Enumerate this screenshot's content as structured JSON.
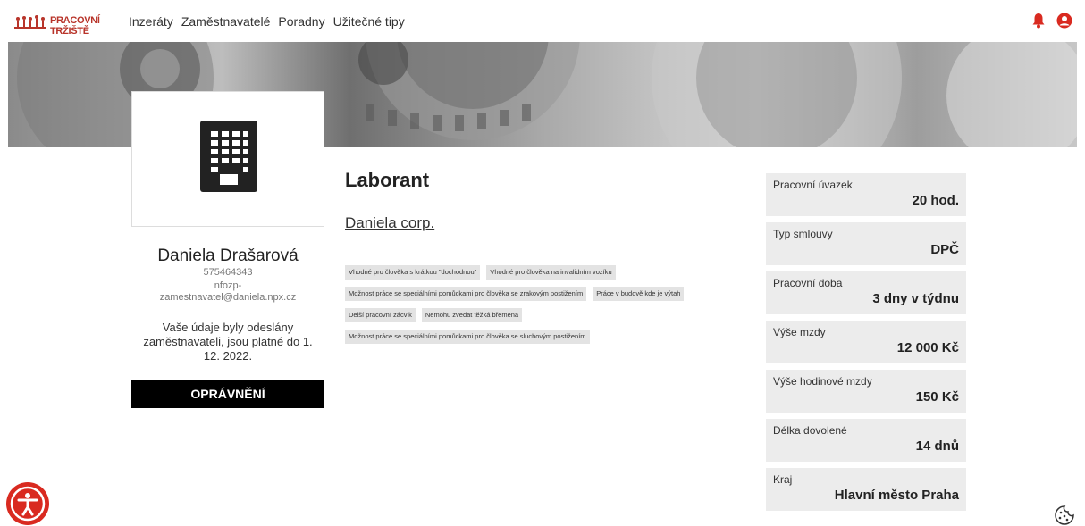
{
  "header": {
    "logo_text": "PRACOVNÍ TRŽIŠTĚ",
    "nav": [
      "Inzeráty",
      "Zaměstnavatelé",
      "Poradny",
      "Užitečné tipy"
    ]
  },
  "profile": {
    "name": "Daniela Drašarová",
    "phone": "575464343",
    "email": "nfozp-zamestnavatel@daniela.npx.cz",
    "status": "Vaše údaje byly odeslány zaměstnavateli, jsou platné do 1. 12. 2022.",
    "button": "OPRÁVNĚNÍ"
  },
  "job": {
    "title": "Laborant",
    "company": "Daniela corp.",
    "tags": [
      "Vhodné pro člověka s krátkou \"dochodnou\"",
      "Vhodné pro člověka na invalidním vozíku",
      "Možnost práce se speciálními pomůckami pro člověka se zrakovým postižením",
      "Práce v budově kde je výtah",
      "Delší pracovní zácvik",
      "Nemohu zvedat těžká břemena",
      "Možnost práce se speciálními pomůckami pro člověka se sluchovým postižením"
    ]
  },
  "details": [
    {
      "label": "Pracovní úvazek",
      "value": "20 hod."
    },
    {
      "label": "Typ smlouvy",
      "value": "DPČ"
    },
    {
      "label": "Pracovní doba",
      "value": "3 dny v týdnu"
    },
    {
      "label": "Výše mzdy",
      "value": "12 000 Kč"
    },
    {
      "label": "Výše hodinové mzdy",
      "value": "150 Kč"
    },
    {
      "label": "Délka dovolené",
      "value": "14 dnů"
    },
    {
      "label": "Kraj",
      "value": "Hlavní město Praha"
    }
  ],
  "icons": {
    "notification": "bell-icon",
    "account": "user-circle-icon",
    "accessibility": "accessibility-icon",
    "cookie": "cookie-icon",
    "company": "building-icon"
  },
  "colors": {
    "accent": "#d92a20",
    "button_bg": "#000000",
    "tag_bg": "#e3e3e3",
    "panel_bg": "#ececec"
  }
}
